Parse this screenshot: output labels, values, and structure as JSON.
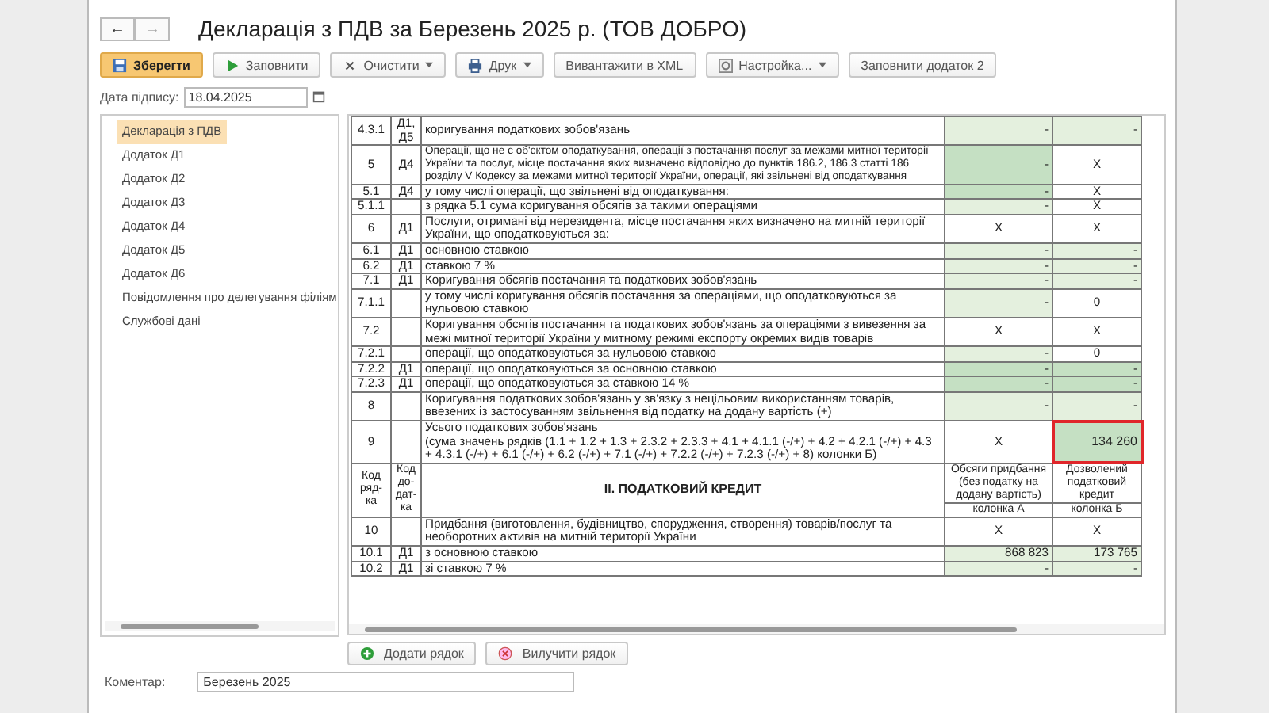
{
  "window": {
    "title": "Декларація з ПДВ за Березень 2025 р. (ТОВ ДОБРО)"
  },
  "nav": [
    {
      "label": "←",
      "disabled": false
    },
    {
      "label": "→",
      "disabled": true
    }
  ],
  "toolbar": [
    {
      "label": "Зберегти",
      "kind": "save",
      "dropdown": false,
      "primary": true
    },
    {
      "label": "Заповнити",
      "kind": "fill",
      "dropdown": false,
      "primary": false
    },
    {
      "label": "Очистити",
      "kind": "clear",
      "dropdown": true,
      "primary": false
    },
    {
      "label": "Друк",
      "kind": "print",
      "dropdown": true,
      "primary": false
    },
    {
      "label": "Вивантажити в XML",
      "kind": "plain",
      "dropdown": false,
      "primary": false
    },
    {
      "label": "Настройка...",
      "kind": "settings",
      "dropdown": true,
      "primary": false
    },
    {
      "label": "Заповнити додаток 2",
      "kind": "plain",
      "dropdown": false,
      "primary": false
    }
  ],
  "date": {
    "label": "Дата підпису:",
    "value": "18.04.2025"
  },
  "sidebar": {
    "items": [
      {
        "label": "Декларація з ПДВ",
        "selected": true
      },
      {
        "label": "Додаток Д1",
        "selected": false
      },
      {
        "label": "Додаток Д2",
        "selected": false
      },
      {
        "label": "Додаток Д3",
        "selected": false
      },
      {
        "label": "Додаток Д4",
        "selected": false
      },
      {
        "label": "Додаток Д5",
        "selected": false
      },
      {
        "label": "Додаток Д6",
        "selected": false
      },
      {
        "label": "Повідомлення про делегування філіям",
        "selected": false
      },
      {
        "label": "Службові дані",
        "selected": false
      }
    ]
  },
  "table": {
    "rows": [
      {
        "kind": "data",
        "code": "4.3.1",
        "annex": "Д1, Д5",
        "text": "коригування податкових зобов'язань",
        "small": false,
        "col_a": {
          "value": "-",
          "filled": true,
          "strong": false,
          "highlighted": false
        },
        "col_b": {
          "value": "-",
          "filled": true,
          "strong": false,
          "highlighted": false
        }
      },
      {
        "kind": "data",
        "code": "5",
        "annex": "Д4",
        "text": "Операції, що не є об'єктом оподаткування, операції з постачання послуг за межами митної території України та послуг, місце постачання яких визначено відповідно до пунктів 186.2, 186.3 статті 186 розділу V Кодексу за межами митної території України, операції, які звільнені від оподаткування",
        "small": true,
        "col_a": {
          "value": "-",
          "filled": true,
          "strong": true,
          "highlighted": false
        },
        "col_b": {
          "value": "X",
          "filled": false,
          "strong": false,
          "highlighted": false
        }
      },
      {
        "kind": "data",
        "code": "5.1",
        "annex": "Д4",
        "text": "у тому числі операції, що звільнені від оподаткування:",
        "small": false,
        "col_a": {
          "value": "-",
          "filled": true,
          "strong": true,
          "highlighted": false
        },
        "col_b": {
          "value": "X",
          "filled": false,
          "strong": false,
          "highlighted": false
        }
      },
      {
        "kind": "data",
        "code": "5.1.1",
        "annex": "",
        "text": "з рядка 5.1 сума коригування обсягів за такими операціями",
        "small": false,
        "col_a": {
          "value": "-",
          "filled": true,
          "strong": false,
          "highlighted": false
        },
        "col_b": {
          "value": "X",
          "filled": false,
          "strong": false,
          "highlighted": false
        }
      },
      {
        "kind": "data",
        "code": "6",
        "annex": "Д1",
        "text": "Послуги, отримані від нерезидента, місце постачання яких визначено на митній території України, що оподатковуються за:",
        "small": false,
        "col_a": {
          "value": "X",
          "filled": false,
          "strong": false,
          "highlighted": false
        },
        "col_b": {
          "value": "X",
          "filled": false,
          "strong": false,
          "highlighted": false
        }
      },
      {
        "kind": "data",
        "code": "6.1",
        "annex": "Д1",
        "text": "основною ставкою",
        "small": false,
        "col_a": {
          "value": "-",
          "filled": true,
          "strong": false,
          "highlighted": false
        },
        "col_b": {
          "value": "-",
          "filled": true,
          "strong": false,
          "highlighted": false
        }
      },
      {
        "kind": "data",
        "code": "6.2",
        "annex": "Д1",
        "text": "ставкою 7 %",
        "small": false,
        "col_a": {
          "value": "-",
          "filled": true,
          "strong": false,
          "highlighted": false
        },
        "col_b": {
          "value": "-",
          "filled": true,
          "strong": false,
          "highlighted": false
        }
      },
      {
        "kind": "data",
        "code": "7.1",
        "annex": "Д1",
        "text": "Коригування обсягів постачання та податкових зобов'язань",
        "small": false,
        "col_a": {
          "value": "-",
          "filled": true,
          "strong": false,
          "highlighted": false
        },
        "col_b": {
          "value": "-",
          "filled": true,
          "strong": false,
          "highlighted": false
        }
      },
      {
        "kind": "data",
        "code": "7.1.1",
        "annex": "",
        "text": "у тому числі коригування обсягів постачання за операціями, що оподатковуються за нульовою ставкою",
        "small": false,
        "col_a": {
          "value": "-",
          "filled": true,
          "strong": false,
          "highlighted": false
        },
        "col_b": {
          "value": "0",
          "filled": false,
          "strong": false,
          "highlighted": false
        }
      },
      {
        "kind": "data",
        "code": "7.2",
        "annex": "",
        "text": "Коригування обсягів постачання та податкових зобов'язань за операціями з вивезення за межі митної території України у митному режимі експорту окремих видів товарів",
        "small": false,
        "col_a": {
          "value": "X",
          "filled": false,
          "strong": false,
          "highlighted": false
        },
        "col_b": {
          "value": "X",
          "filled": false,
          "strong": false,
          "highlighted": false
        }
      },
      {
        "kind": "data",
        "code": "7.2.1",
        "annex": "",
        "text": "операції, що оподатковуються за нульовою ставкою",
        "small": false,
        "col_a": {
          "value": "-",
          "filled": true,
          "strong": false,
          "highlighted": false
        },
        "col_b": {
          "value": "0",
          "filled": false,
          "strong": false,
          "highlighted": false
        }
      },
      {
        "kind": "data",
        "code": "7.2.2",
        "annex": "Д1",
        "text": "операції, що оподатковуються за основною ставкою",
        "small": false,
        "col_a": {
          "value": "-",
          "filled": true,
          "strong": true,
          "highlighted": false
        },
        "col_b": {
          "value": "-",
          "filled": true,
          "strong": true,
          "highlighted": false
        }
      },
      {
        "kind": "data",
        "code": "7.2.3",
        "annex": "Д1",
        "text": "операції, що оподатковуються за ставкою 14 %",
        "small": false,
        "col_a": {
          "value": "-",
          "filled": true,
          "strong": true,
          "highlighted": false
        },
        "col_b": {
          "value": "-",
          "filled": true,
          "strong": true,
          "highlighted": false
        }
      },
      {
        "kind": "data",
        "code": "8",
        "annex": "",
        "text": "Коригування податкових зобов'язань у зв'язку з нецільовим використанням товарів, ввезених із застосуванням звільнення від податку на додану вартість (+)",
        "small": false,
        "col_a": {
          "value": "-",
          "filled": true,
          "strong": false,
          "highlighted": false
        },
        "col_b": {
          "value": "-",
          "filled": true,
          "strong": false,
          "highlighted": false
        }
      },
      {
        "kind": "data",
        "code": "9",
        "annex": "",
        "text": "Усього податкових зобов'язань\n(сума значень рядків (1.1 + 1.2 + 1.3 + 2.3.2 + 2.3.3 + 4.1 + 4.1.1 (-/+) + 4.2 + 4.2.1 (-/+) + 4.3 + 4.3.1 (-/+) + 6.1 (-/+) + 6.2 (-/+) + 7.1 (-/+) + 7.2.2 (-/+) + 7.2.3 (-/+) + 8) колонки Б)",
        "small": false,
        "col_a": {
          "value": "X",
          "filled": false,
          "strong": false,
          "highlighted": false
        },
        "col_b": {
          "value": "134 260",
          "filled": true,
          "strong": true,
          "highlighted": true
        }
      },
      {
        "kind": "section",
        "code": "Код ряд-ка",
        "annex": "Код до-дат-ка",
        "title": "II. ПОДАТКОВИЙ КРЕДИТ",
        "col_a": "Обсяги придбання (без податку на додану вартість)",
        "col_b": "Дозволений податковий кредит",
        "col_a_sub": "колонка А",
        "col_b_sub": "колонка Б"
      },
      {
        "kind": "data",
        "code": "10",
        "annex": "",
        "text": "Придбання (виготовлення, будівництво, спорудження, створення) товарів/послуг та необоротних активів на митній території України",
        "small": false,
        "col_a": {
          "value": "X",
          "filled": false,
          "strong": false,
          "highlighted": false
        },
        "col_b": {
          "value": "X",
          "filled": false,
          "strong": false,
          "highlighted": false
        }
      },
      {
        "kind": "data",
        "code": "10.1",
        "annex": "Д1",
        "text": "з  основною ставкою",
        "small": false,
        "col_a": {
          "value": "868 823",
          "filled": true,
          "strong": false,
          "highlighted": false
        },
        "col_b": {
          "value": "173 765",
          "filled": true,
          "strong": false,
          "highlighted": false
        }
      },
      {
        "kind": "data",
        "code": "10.2",
        "annex": "Д1",
        "text": "зі ставкою 7 %",
        "small": false,
        "col_a": {
          "value": "-",
          "filled": true,
          "strong": false,
          "highlighted": false
        },
        "col_b": {
          "value": "-",
          "filled": true,
          "strong": false,
          "highlighted": false
        }
      }
    ]
  },
  "buttons": [
    {
      "label": "Додати рядок",
      "kind": "add"
    },
    {
      "label": "Вилучити рядок",
      "kind": "delete"
    }
  ],
  "comment": {
    "label": "Коментар:",
    "value": "Березень 2025"
  }
}
